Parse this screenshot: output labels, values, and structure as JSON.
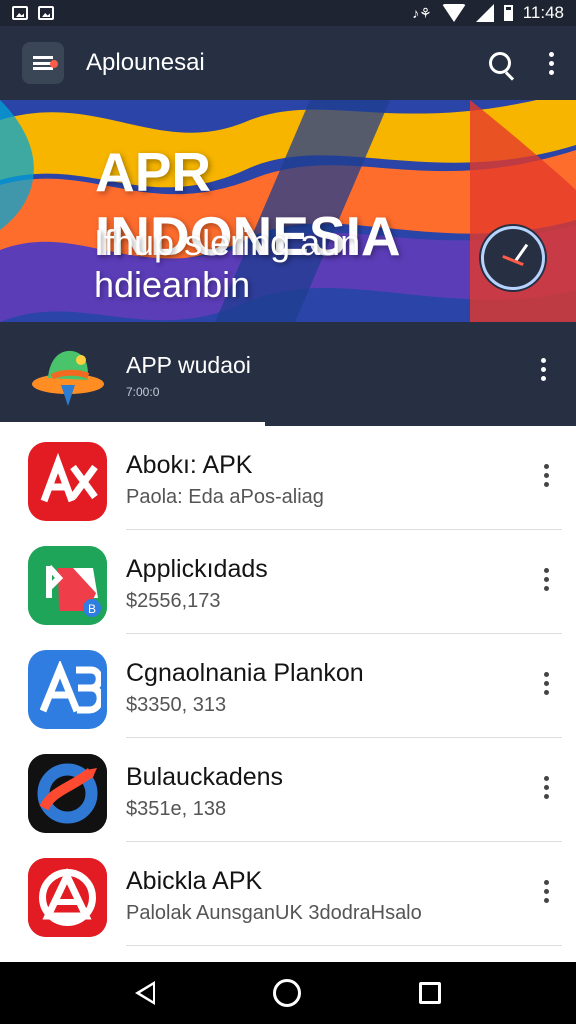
{
  "status_bar": {
    "time": "11:48",
    "mini": "♪⚘"
  },
  "app_bar": {
    "title": "Aplounesai",
    "icons": [
      "menu-icon",
      "search-icon",
      "more-vert-icon"
    ]
  },
  "banner": {
    "title": "APR INDONESIA",
    "subtitle": "Ifhup slering aun hdieanbin",
    "icon": "clock-icon"
  },
  "section": {
    "title": "APP wudaoi",
    "subtitle": "7:00:0",
    "icon": "hat-icon"
  },
  "list": {
    "items": [
      {
        "title": "Abokı: APK",
        "subtitle": "Paola: Eda aPos-aliag",
        "icon": "ax-icon"
      },
      {
        "title": "Applickıdads",
        "subtitle": "$2556,173",
        "icon": "folder-icon"
      },
      {
        "title": "Cgnaolnania Plankon",
        "subtitle": "$3350, 313",
        "icon": "ab-icon"
      },
      {
        "title": "Bulauckadens",
        "subtitle": "$351e, 138",
        "icon": "swirl-icon"
      },
      {
        "title": "Abickla APK",
        "subtitle": "Palolak AunsganUK 3dodraHsalo",
        "icon": "triangle-icon"
      }
    ]
  },
  "colors": {
    "primary": "#263042",
    "accent": "#ff5b46",
    "red_icon": "#e31b23",
    "blue_icon": "#2f7de1",
    "green_icon": "#1fa55a"
  }
}
